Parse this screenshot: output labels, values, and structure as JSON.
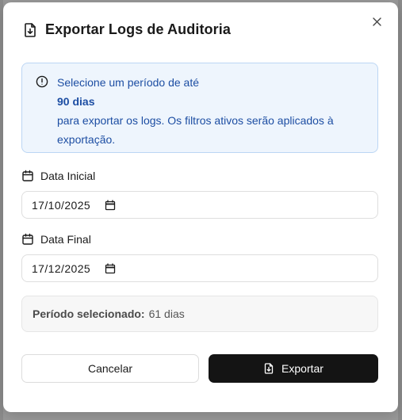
{
  "modal": {
    "title": "Exportar Logs de Auditoria",
    "close_label": "×"
  },
  "info": {
    "line1": "Selecione um período de até",
    "highlight": "90 dias",
    "line2": "para exportar os logs. Os filtros ativos serão aplicados à exportação."
  },
  "start_date": {
    "label": "Data Inicial",
    "value": "17/10/2025"
  },
  "end_date": {
    "label": "Data Final",
    "value": "17/12/2025"
  },
  "summary": {
    "key": "Período selecionado:",
    "value": "61 dias"
  },
  "buttons": {
    "cancel": "Cancelar",
    "export": "Exportar"
  },
  "colors": {
    "info_bg": "#eef5fd",
    "info_text": "#1d4ea3",
    "primary": "#141414"
  }
}
